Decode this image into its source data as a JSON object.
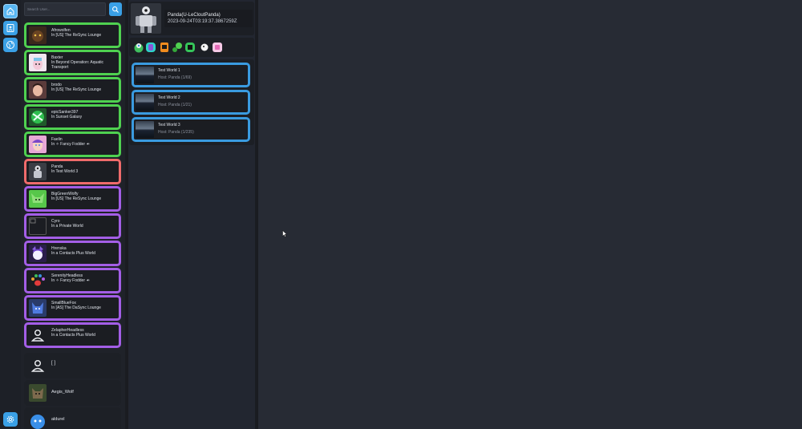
{
  "search": {
    "placeholder": "Search User..."
  },
  "friends": [
    {
      "name": "Afrowolfen",
      "location": "In [US] The ReSync Lounge",
      "status_color": "#4fd150"
    },
    {
      "name": "Baxter",
      "location": "In Beyond Operation: Aquatic Transport",
      "status_color": "#4fd150"
    },
    {
      "name": "brodo",
      "location": "In [US] The ReSync Lounge",
      "status_color": "#4fd150"
    },
    {
      "name": "epicSanker397",
      "location": "In Sunset Galaxy",
      "status_color": "#4fd150"
    },
    {
      "name": "Faelin",
      "location": "In ✧ Fancy Fodder ☙",
      "status_color": "#4fd150"
    },
    {
      "name": "Panda",
      "location": "In Test World 3",
      "status_color": "#ef6b6b"
    },
    {
      "name": "BigGreenWolfy",
      "location": "In [US] The ReSync Lounge",
      "status_color": "#a35ee6"
    },
    {
      "name": "Cyro",
      "location": "In a Private World",
      "status_color": "#a35ee6"
    },
    {
      "name": "Hrenska",
      "location": "In a Contacts Plus World",
      "status_color": "#a35ee6"
    },
    {
      "name": "SerenityHeadless",
      "location": "In ✧ Fancy Fodder ☙",
      "status_color": "#a35ee6"
    },
    {
      "name": "SmallBlueFox",
      "location": "In [AS] The DaSync Lounge",
      "status_color": "#a35ee6"
    },
    {
      "name": "ZelapherHeadless",
      "location": "In a Contacts Plus World",
      "status_color": "#a35ee6"
    },
    {
      "name": "",
      "location": "[  ]",
      "status_color": ""
    },
    {
      "name": "Aegis_Wolf",
      "location": "",
      "status_color": ""
    },
    {
      "name": "aldurel",
      "location": "",
      "status_color": ""
    }
  ],
  "profile": {
    "username": "Panda(U-LeCloutPanda)",
    "date": "2023-09-24T03:19:37.3867259Z"
  },
  "badges": [
    "mentor-badge",
    "cyan-badge",
    "orange-badge",
    "green-badge",
    "green-phone-badge",
    "white-badge",
    "pink-badge"
  ],
  "worlds": [
    {
      "name": "Test World 1",
      "host": "Host: Panda (1/69)"
    },
    {
      "name": "Test World 2",
      "host": "Host: Panda (1/21)"
    },
    {
      "name": "Test World 3",
      "host": "Host: Panda (1/235)"
    }
  ],
  "colors": {
    "accent": "#3aa0e6",
    "online": "#4fd150",
    "busy": "#ef6b6b",
    "away": "#a35ee6",
    "world_border": "#3a9be0"
  }
}
